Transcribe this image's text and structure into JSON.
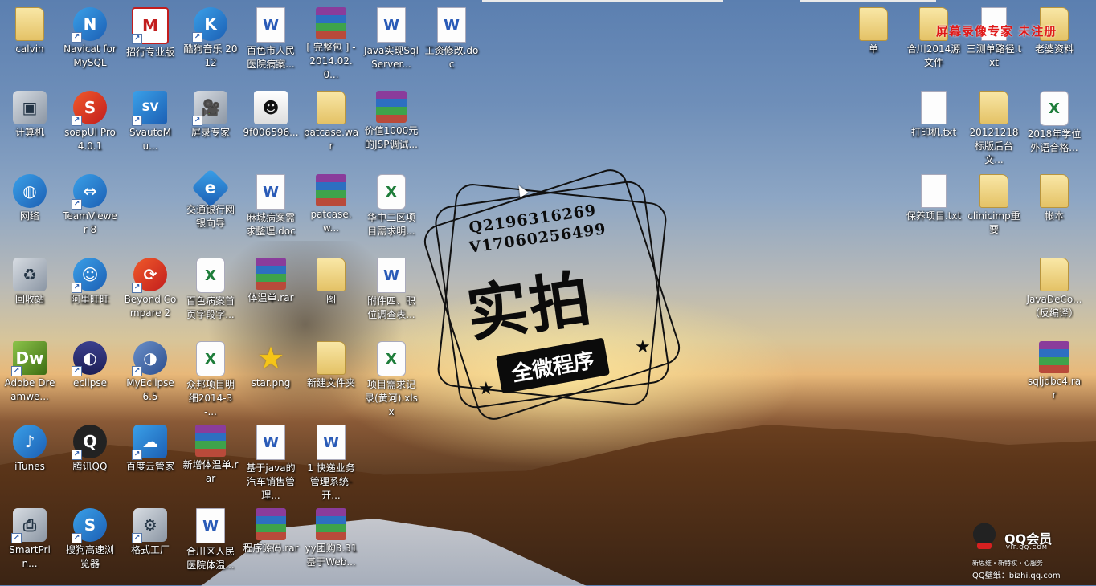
{
  "watermark": {
    "top_text": "屏幕录像专家  未注册",
    "stamp_q": "Q2196316269",
    "stamp_v": "V17060256499",
    "stamp_big": "实拍",
    "stamp_ribbon": "全微程序"
  },
  "qq_member": {
    "title": "QQ会员",
    "url": "VIP.QQ.COM",
    "slogan": "新思维・新特权・心服务",
    "site": "QQ壁纸：bizhi.qq.com"
  },
  "icons": [
    {
      "label": "calvin",
      "icon": "user-folder-icon"
    },
    {
      "label": "Navicat for MySQL",
      "icon": "navicat-icon"
    },
    {
      "label": "招行专业版",
      "icon": "cmb-icon"
    },
    {
      "label": "酷狗音乐 2012",
      "icon": "kugou-icon"
    },
    {
      "label": "百色市人民医院病案...",
      "icon": "word-doc-icon"
    },
    {
      "label": "[ 完整包 ] - 2014.02.0...",
      "icon": "rar-icon"
    },
    {
      "label": "Java实现SqlServer...",
      "icon": "word-doc-icon"
    },
    {
      "label": "工资修改.doc",
      "icon": "word-doc-icon"
    },
    {
      "label": "计算机",
      "icon": "computer-icon"
    },
    {
      "label": "soapUI Pro 4.0.1",
      "icon": "soapui-icon"
    },
    {
      "label": "SvautoMu...",
      "icon": "svauto-icon"
    },
    {
      "label": "屏录专家",
      "icon": "screen-recorder-icon"
    },
    {
      "label": "9f006596...",
      "icon": "image-icon"
    },
    {
      "label": "patcase.war",
      "icon": "folder-icon"
    },
    {
      "label": "价值1000元的JSP调试...",
      "icon": "rar-icon"
    },
    {
      "label": "网络",
      "icon": "network-icon"
    },
    {
      "label": "TeamViewer 8",
      "icon": "teamviewer-icon"
    },
    {
      "label": "交通银行网银向导",
      "icon": "bocom-icon"
    },
    {
      "label": "麻城病案需求整理.doc",
      "icon": "word-doc-icon"
    },
    {
      "label": "patcase.w...",
      "icon": "rar-icon"
    },
    {
      "label": "华中二区项目需求明...",
      "icon": "excel-icon"
    },
    {
      "label": "回收站",
      "icon": "recycle-bin-icon"
    },
    {
      "label": "阿里旺旺",
      "icon": "aliwangwang-icon"
    },
    {
      "label": "Beyond Compare 2",
      "icon": "beyond-compare-icon"
    },
    {
      "label": "百色病案首页字段字...",
      "icon": "excel-icon"
    },
    {
      "label": "体温单.rar",
      "icon": "rar-icon"
    },
    {
      "label": "图",
      "icon": "folder-icon"
    },
    {
      "label": "附件四、职位调查表...",
      "icon": "word-doc-icon"
    },
    {
      "label": "Adobe Dreamwe...",
      "icon": "dreamweaver-icon"
    },
    {
      "label": "eclipse",
      "icon": "eclipse-icon"
    },
    {
      "label": "MyEclipse 6.5",
      "icon": "myeclipse-icon"
    },
    {
      "label": "众邦项目明细2014-3-...",
      "icon": "excel-icon"
    },
    {
      "label": "star.png",
      "icon": "star-icon"
    },
    {
      "label": "新建文件夹",
      "icon": "folder-icon"
    },
    {
      "label": "项目需求记录(黄河).xlsx",
      "icon": "excel-icon"
    },
    {
      "label": "iTunes",
      "icon": "itunes-icon"
    },
    {
      "label": "腾讯QQ",
      "icon": "qq-icon"
    },
    {
      "label": "百度云管家",
      "icon": "baidu-cloud-icon"
    },
    {
      "label": "新增体温单.rar",
      "icon": "rar-icon"
    },
    {
      "label": "基于java的汽车销售管理...",
      "icon": "word-doc-icon"
    },
    {
      "label": "1 快递业务管理系统-开...",
      "icon": "word-doc-icon"
    },
    {
      "label": "SmartPrin...",
      "icon": "printer-icon"
    },
    {
      "label": "搜狗高速浏览器",
      "icon": "sogou-browser-icon"
    },
    {
      "label": "格式工厂",
      "icon": "format-factory-icon"
    },
    {
      "label": "合川区人民医院体温...",
      "icon": "word-doc-icon"
    },
    {
      "label": "程序源码.rar",
      "icon": "rar-icon"
    },
    {
      "label": "yy团购3.31基于Web...",
      "icon": "rar-icon"
    },
    {
      "label": "单",
      "icon": "folder-icon"
    },
    {
      "label": "合川2014源文件",
      "icon": "folder-icon"
    },
    {
      "label": "三测单路径.txt",
      "icon": "text-file-icon"
    },
    {
      "label": "老婆资料",
      "icon": "folder-icon"
    },
    {
      "label": "打印机.txt",
      "icon": "text-file-icon"
    },
    {
      "label": "20121218标版后台文...",
      "icon": "folder-icon"
    },
    {
      "label": "2018年学位外语合格...",
      "icon": "excel-icon"
    },
    {
      "label": "保养项目.txt",
      "icon": "text-file-icon"
    },
    {
      "label": "clinicimp重要",
      "icon": "folder-icon"
    },
    {
      "label": "帐本",
      "icon": "folder-icon"
    },
    {
      "label": "JavaDeCo...（反编译）",
      "icon": "folder-icon"
    },
    {
      "label": "sqljdbc4.rar",
      "icon": "rar-icon"
    }
  ]
}
